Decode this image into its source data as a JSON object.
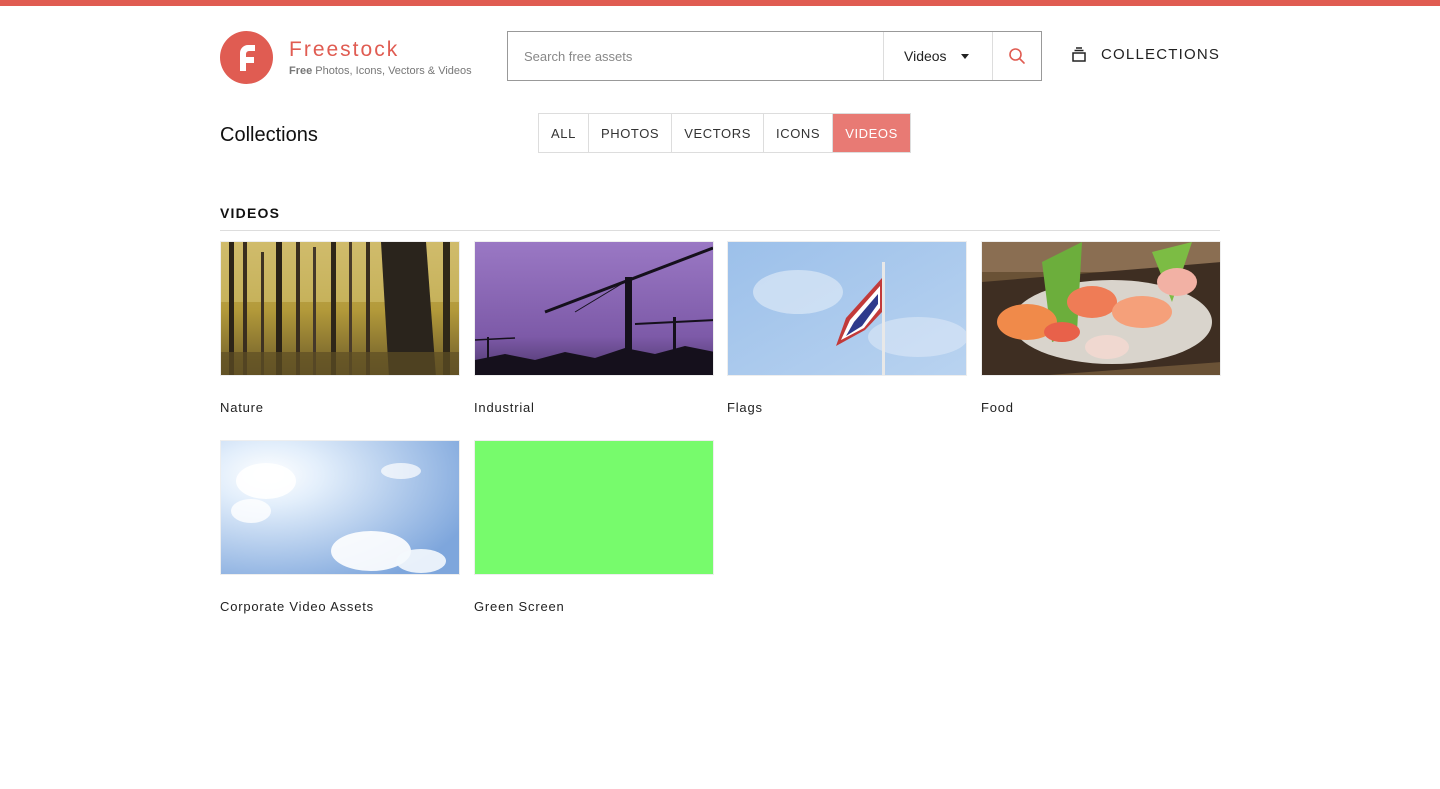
{
  "brand": {
    "name": "Freestock",
    "tagline_bold": "Free",
    "tagline_rest": " Photos, Icons, Vectors & Videos",
    "accent_color": "#e05c52"
  },
  "search": {
    "placeholder": "Search free assets",
    "type_selected": "Videos"
  },
  "header": {
    "collections_label": "COLLECTIONS"
  },
  "page": {
    "title": "Collections"
  },
  "filters": {
    "tabs": [
      "ALL",
      "PHOTOS",
      "VECTORS",
      "ICONS",
      "VIDEOS"
    ],
    "active": "VIDEOS"
  },
  "section": {
    "title": "VIDEOS",
    "items": [
      {
        "label": "Nature",
        "thumb": "forest"
      },
      {
        "label": "Industrial",
        "thumb": "crane-sunset"
      },
      {
        "label": "Flags",
        "thumb": "flag-sky"
      },
      {
        "label": "Food",
        "thumb": "sashimi"
      },
      {
        "label": "Corporate Video Assets",
        "thumb": "clouds"
      },
      {
        "label": "Green Screen",
        "thumb": "green"
      }
    ]
  }
}
